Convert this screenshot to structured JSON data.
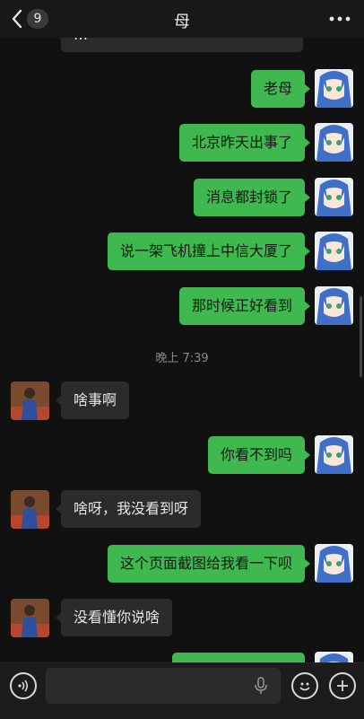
{
  "header": {
    "unread_count": "9",
    "title": "母"
  },
  "top_partial_message": "…",
  "messages": [
    {
      "sender": "me",
      "text": "老母"
    },
    {
      "sender": "me",
      "text": "北京昨天出事了"
    },
    {
      "sender": "me",
      "text": "消息都封锁了"
    },
    {
      "sender": "me",
      "text": "说一架飞机撞上中信大厦了"
    },
    {
      "sender": "me",
      "text": "那时候正好看到"
    },
    {
      "sender": "other",
      "text": "啥事啊"
    },
    {
      "sender": "me",
      "text": "你看不到吗"
    },
    {
      "sender": "other",
      "text": "啥呀，我没看到呀"
    },
    {
      "sender": "me",
      "text": "这个页面截图给我看一下呗"
    },
    {
      "sender": "other",
      "text": "没看懂你说啥"
    }
  ],
  "timestamp": "晚上 7:39",
  "icons": {
    "back": "chevron-left-icon",
    "more": "more-dots-icon",
    "voice": "voice-icon",
    "mic": "microphone-icon",
    "emoji": "emoji-icon",
    "plus": "plus-icon"
  },
  "colors": {
    "my_bubble": "#3fb94f",
    "other_bubble": "#2b2b2b",
    "background": "#111111"
  }
}
